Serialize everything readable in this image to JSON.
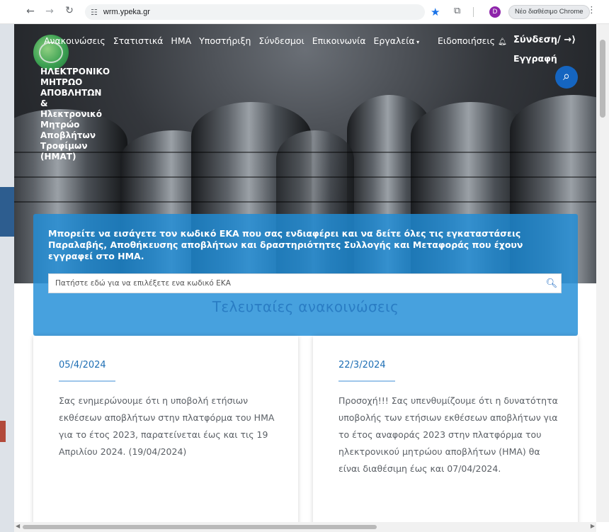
{
  "browser": {
    "url": "wrm.ypeka.gr",
    "chrome_button": "Νέο διαθέσιμο Chrome",
    "profile_initial": "D"
  },
  "site": {
    "brand_lines": [
      "ΗΛΕΚΤΡΟΝΙΚΟ",
      "ΜΗΤΡΩΟ",
      "ΑΠΟΒΛΗΤΩΝ",
      "&",
      "Ηλεκτρονικό",
      "Μητρώο",
      "Αποβλήτων",
      "Τροφίμων",
      "(ΗΜΑΤ)"
    ],
    "nav": [
      "Ανακοινώσεις",
      "Στατιστικά",
      "ΗΜΑ",
      "Υποστήριξη",
      "Σύνδεσμοι",
      "Επικοινωνία",
      "Εργαλεία"
    ],
    "notifications": "Ειδοποιήσεις",
    "login": "Σύνδεση/",
    "register": "Εγγραφή"
  },
  "eka": {
    "description": "Μπορείτε να εισάγετε τον κωδικό ΕΚΑ που σας ενδιαφέρει και να δείτε όλες τις εγκαταστάσεις Παραλαβής, Αποθήκευσης αποβλήτων και δραστηριότητες Συλλογής και Μεταφοράς που έχουν εγγραφεί στο ΗΜΑ.",
    "placeholder": "Πατήστε εδώ για να επιλέξετε ενα κωδικό ΕΚΑ"
  },
  "announcements": {
    "title": "Τελευταίες ανακοινώσεις",
    "items": [
      {
        "date": "05/4/2024",
        "text": "Σας ενημερώνουμε ότι η υποβολή ετήσιων εκθέσεων αποβλήτων στην πλατφόρμα του ΗΜΑ για το έτος 2023, παρατείνεται έως και τις 19 Απριλίου 2024. (19/04/2024)"
      },
      {
        "date": "22/3/2024",
        "text": "Προσοχή!!! Σας υπενθυμίζουμε ότι η δυνατότητα υποβολής των ετήσιων εκθέσεων αποβλήτων για το έτος αναφοράς 2023 στην πλατφόρμα του ηλεκτρονικού μητρώου αποβλήτων (ΗΜΑ) θα είναι διαθέσιμη έως και 07/04/2024."
      }
    ]
  },
  "colors": {
    "accent_blue": "#1e8cd7",
    "title_blue": "#2a7dc4",
    "date_blue": "#1f6fb5",
    "button_blue": "#1565c0"
  }
}
